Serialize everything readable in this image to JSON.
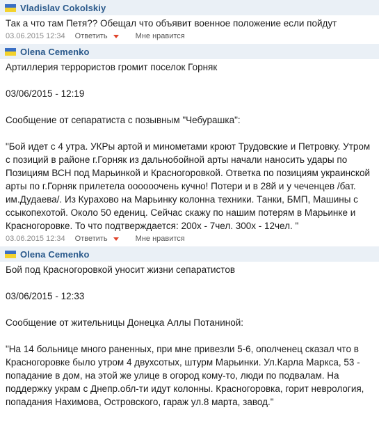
{
  "comments": [
    {
      "author": "Vladislav Cokolskiy",
      "text": "Так а что там Петя?? Обещал что объявит военное положение если пойдут",
      "date": "03.06.2015 12:34",
      "reply": "Ответить",
      "like": "Мне нравится"
    },
    {
      "author": "Olena Cemenko",
      "text": "Артиллерия террористов громит поселок Горняк\n\n03/06/2015 - 12:19\n\nСообщение от сепаратиста с позывным \"Чебурашка\":\n\n\"Бой идет с 4 утра. УКРы артой и минометами кроют Трудовские и Петровку. Утром с позиций в районе г.Горняк из дальнобойной арты начали наносить удары по Позициям ВСН под Марьинкой и Красногоровкой. Ответка по позициям украинской арты по г.Горняк прилетела оооооочень кучно! Потери и в 28й и у чеченцев /бат. им.Дудаева/. Из Курахово на Марьинку колонна техники. Танки, БМП, Машины с ссыкопехотой. Около 50 едениц. Сейчас скажу по нашим потерям в Марьинке и Красногоровке. То что подтверждается: 200х - 7чел. 300х - 12чел. \"",
      "date": "03.06.2015 12:34",
      "reply": "Ответить",
      "like": "Мне нравится"
    },
    {
      "author": "Olena Cemenko",
      "text": "Бой под Красногоровкой уносит жизни сепаратистов\n\n03/06/2015 - 12:33\n\nСообщение от жительницы Донецка Аллы Потаниной:\n\n\"На 14 больнице много раненных, при мне привезли 5-6, ополченец сказал что в Красногоровке было утром 4 двухсотых, штурм Марьинки. Ул.Карла Маркса, 53 - попадание в дом, на этой же улице в огород кому-то, люди по подвалам. На поддержку украм с Днепр.обл-ти идут колонны. Красногоровка, горит неврология, попадания Нахимова, Островского, гараж ул.8 марта, завод.\""
    }
  ],
  "colors": {
    "author": "#2b5a8c",
    "header_bg": "#eaf0f6",
    "caret": "#e0442b"
  },
  "icons": {
    "flag": "ukraine-flag-icon",
    "caret": "caret-down-icon"
  }
}
